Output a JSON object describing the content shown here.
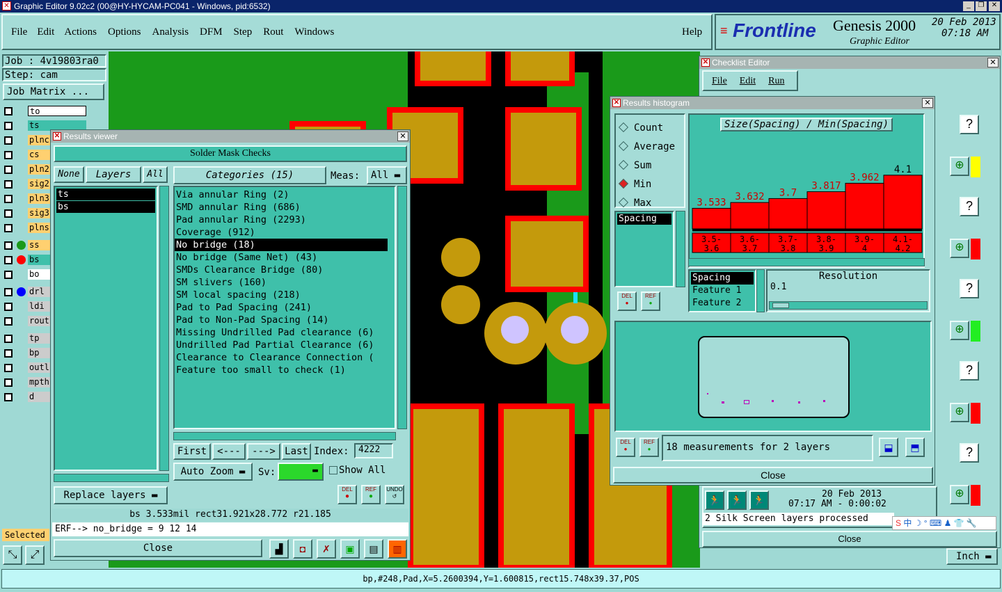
{
  "window_title": "Graphic Editor 9.02c2 (00@HY-HYCAM-PC041 - Windows, pid:6532)",
  "menu": [
    "File",
    "Edit",
    "Actions",
    "Options",
    "Analysis",
    "DFM",
    "Step",
    "Rout",
    "Windows"
  ],
  "help": "Help",
  "brand": {
    "logo": "Frontline",
    "product": "Genesis 2000",
    "subtitle": "Graphic Editor",
    "date": "20 Feb 2013",
    "time": "07:18 AM"
  },
  "job": {
    "job": "Job : 4v19803ra0",
    "step": "Step: cam",
    "matrix": "Job Matrix ..."
  },
  "layers": [
    "to",
    "ts",
    "plnc",
    "cs",
    "pln2",
    "sig2",
    "pln3",
    "sig3",
    "plns",
    "ss",
    "bs",
    "bo",
    "drl",
    "ldi",
    "rout",
    "tp",
    "bp",
    "outl",
    "mpth",
    "d"
  ],
  "selected_label": "Selected",
  "results_viewer": {
    "title": "Results viewer",
    "heading": "Solder Mask Checks",
    "none": "None",
    "layers": "Layers",
    "all": "All",
    "layer_list": [
      "ts",
      "bs"
    ],
    "categories_label": "Categories (15)",
    "meas_label": "Meas:",
    "meas_value": "All",
    "categories": [
      "Via annular Ring (2)",
      "SMD annular Ring (686)",
      "Pad annular Ring (2293)",
      "Coverage (912)",
      "No bridge (18)",
      "No bridge (Same Net) (43)",
      "SMDs Clearance Bridge (80)",
      "SM slivers (160)",
      "SM local spacing (218)",
      "Pad to Pad Spacing (241)",
      "Pad to Non-Pad Spacing (14)",
      "Missing Undrilled Pad clearance (6)",
      "Undrilled Pad Partial Clearance (6)",
      "Clearance to Clearance Connection (",
      "Feature too small to check (1)"
    ],
    "first": "First",
    "prev": "<---",
    "next": "--->",
    "last": "Last",
    "index_label": "Index:",
    "index_value": "4222",
    "auto_zoom": "Auto Zoom",
    "sv_label": "Sv:",
    "show_all": "Show All",
    "replace_layers": "Replace layers",
    "del": "DEL",
    "ref": "REF",
    "undo": "UNDO",
    "status": "bs 3.533mil   rect31.921x28.772   r21.185",
    "erf": "ERF--> no_bridge = 9 12 14",
    "close": "Close"
  },
  "checklist_editor": {
    "title": "Checklist Editor",
    "menu": [
      "File",
      "Edit",
      "Run"
    ],
    "date": "20 Feb 2013",
    "time": "07:17 AM - 0:00:02",
    "message": "2 Silk Screen layers processed",
    "close": "Close"
  },
  "histogram": {
    "title": "Results histogram",
    "options": [
      "Count",
      "Average",
      "Sum",
      "Min",
      "Max"
    ],
    "selected": "Min",
    "chart_title": "Size(Spacing) / Min(Spacing)",
    "list": [
      "Spacing"
    ],
    "attrs": [
      "Spacing",
      "Feature 1",
      "Feature 2"
    ],
    "resolution_label": "Resolution",
    "resolution_value": "0.1",
    "measurements": "18 measurements for 2 layers",
    "close": "Close"
  },
  "chart_data": {
    "type": "bar",
    "title": "Size(Spacing) / Min(Spacing)",
    "categories": [
      "3.5-3.6",
      "3.6-3.7",
      "3.7-3.8",
      "3.8-3.9",
      "3.9-4",
      "4.1-4.2"
    ],
    "values": [
      3.533,
      3.632,
      3.7,
      3.817,
      3.962,
      4.1
    ],
    "labels": [
      "3.533",
      "3.632",
      "3.7",
      "3.817",
      "3.962",
      "4.1"
    ],
    "bin_top": [
      "3.5-",
      "3.6-",
      "3.7-",
      "3.8-",
      "3.9-",
      "4.1-"
    ],
    "bin_bot": [
      "3.6",
      "3.7",
      "3.8",
      "3.9",
      "4",
      "4.2"
    ],
    "bar_color": "#ff0000"
  },
  "units": "Inch",
  "status_bar": "bp,#248,Pad,X=5.2600394,Y=1.600815,rect15.748x39.37,POS"
}
